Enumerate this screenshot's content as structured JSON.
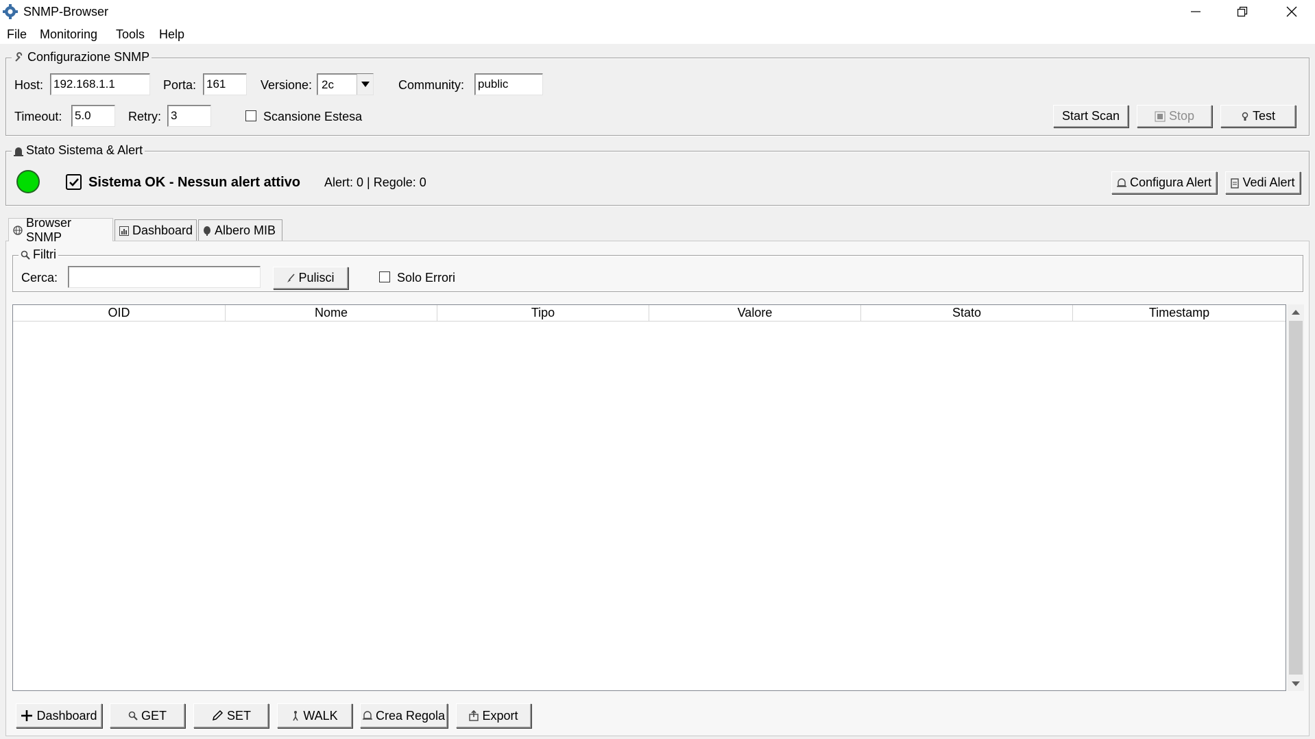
{
  "window": {
    "title": "SNMP-Browser",
    "icons": {
      "app": "gear-icon",
      "minimize": "minimize-icon",
      "restore": "restore-icon",
      "close": "close-icon"
    }
  },
  "menu": [
    "File",
    "Monitoring",
    "Tools",
    "Help"
  ],
  "config": {
    "title": "Configurazione SNMP",
    "host_label": "Host:",
    "host_value": "192.168.1.1",
    "port_label": "Porta:",
    "port_value": "161",
    "version_label": "Versione:",
    "version_value": "2c",
    "community_label": "Community:",
    "community_value": "public",
    "timeout_label": "Timeout:",
    "timeout_value": "5.0",
    "retry_label": "Retry:",
    "retry_value": "3",
    "extended_label": "Scansione Estesa",
    "start_label": "Start Scan",
    "stop_label": "Stop",
    "test_label": "Test"
  },
  "status": {
    "title": "Stato Sistema & Alert",
    "led_color": "#00dd00",
    "message": "Sistema OK - Nessun alert attivo",
    "counts": "Alert: 0 | Regole: 0",
    "configure_label": "Configura Alert",
    "view_label": "Vedi Alert"
  },
  "tabs": [
    {
      "label": "Browser SNMP",
      "icon": "globe-icon",
      "active": true
    },
    {
      "label": "Dashboard",
      "icon": "bar-chart-icon",
      "active": false
    },
    {
      "label": "Albero MIB",
      "icon": "tree-icon",
      "active": false
    }
  ],
  "filters": {
    "title": "Filtri",
    "search_label": "Cerca:",
    "search_value": "",
    "clear_label": "Pulisci",
    "errors_only_label": "Solo Errori"
  },
  "table": {
    "columns": [
      "OID",
      "Nome",
      "Tipo",
      "Valore",
      "Stato",
      "Timestamp"
    ],
    "rows": []
  },
  "actions": {
    "dashboard_label": "Dashboard",
    "get_label": "GET",
    "set_label": "SET",
    "walk_label": "WALK",
    "rule_label": "Crea Regola",
    "export_label": "Export"
  }
}
